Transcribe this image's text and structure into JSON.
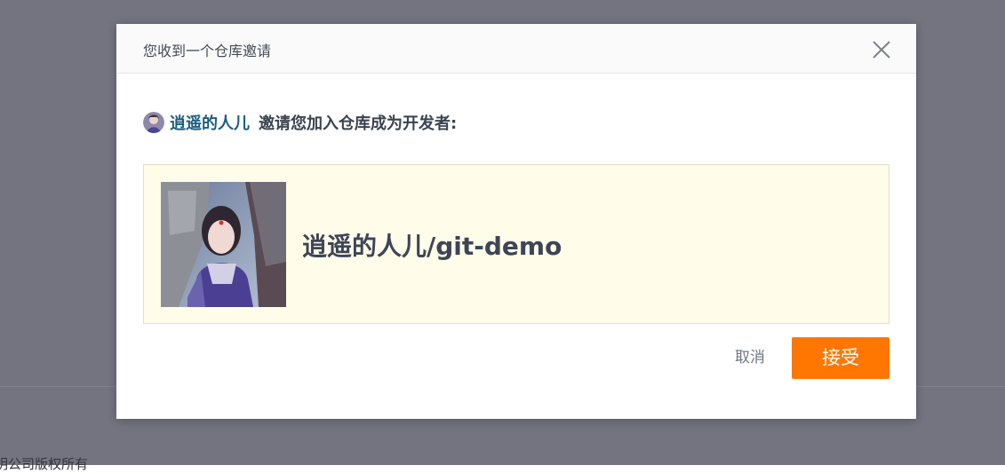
{
  "background": {
    "footer_text": "明公司版权所有"
  },
  "dialog": {
    "title": "您收到一个仓库邀请",
    "close_icon": "close-icon",
    "inviter_name": "逍遥的人儿",
    "invite_text": "邀请您加入仓库成为开发者:",
    "repo_full_name": "逍遥的人儿/git-demo",
    "cancel_label": "取消",
    "accept_label": "接受"
  },
  "colors": {
    "overlay": "#737480",
    "accent_button": "#ff7700",
    "link": "#1a5e80",
    "card_background": "#fffdea"
  }
}
